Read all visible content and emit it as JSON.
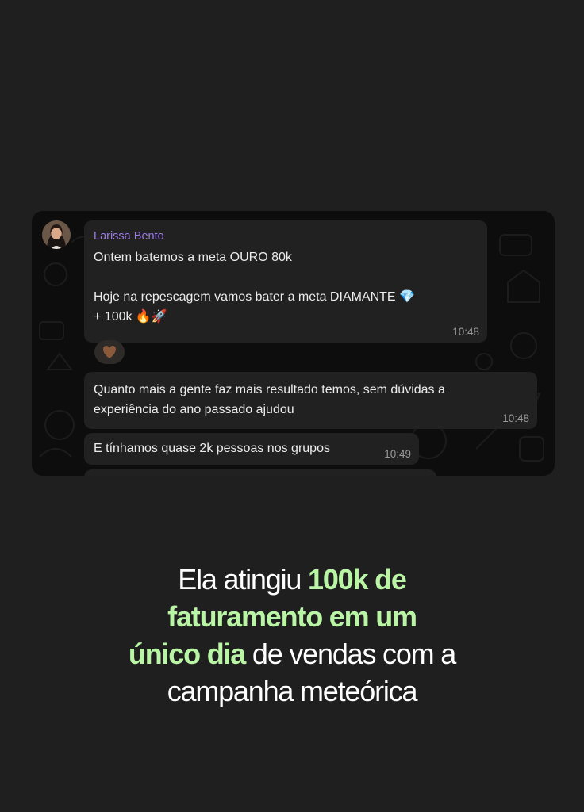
{
  "chat": {
    "messages": [
      {
        "sender": "Larissa Bento",
        "lines": [
          "Ontem batemos a meta OURO 80k",
          "",
          "Hoje na repescagem vamos bater a meta DIAMANTE 💎",
          "+ 100k 🔥🚀"
        ],
        "time": "10:48",
        "reaction": "🤎"
      },
      {
        "lines": [
          "Quanto mais a gente faz mais resultado temos, sem dúvidas a",
          "experiência do ano passado ajudou"
        ],
        "time": "10:48"
      },
      {
        "lines": [
          "E tínhamos quase 2k pessoas nos grupos"
        ],
        "time": "10:49"
      }
    ],
    "avatar_icon": "user-avatar-photo",
    "colors": {
      "sender_name": "#9b7be6",
      "bubble": "#212121",
      "chat_background": "#0d0d0d"
    }
  },
  "caption": {
    "parts": [
      {
        "text": "Ela atingiu ",
        "highlight": false
      },
      {
        "text": "100k de faturamento em um único dia",
        "highlight": true
      },
      {
        "text": " de vendas com a campanha meteórica",
        "highlight": false
      }
    ],
    "line1_a": "Ela atingiu ",
    "line1_b": "100k de",
    "line2": "faturamento em um",
    "line3_a": "único dia",
    "line3_b": " de vendas com a",
    "line4": "campanha meteórica",
    "highlight_color": "#b9f5a5"
  }
}
